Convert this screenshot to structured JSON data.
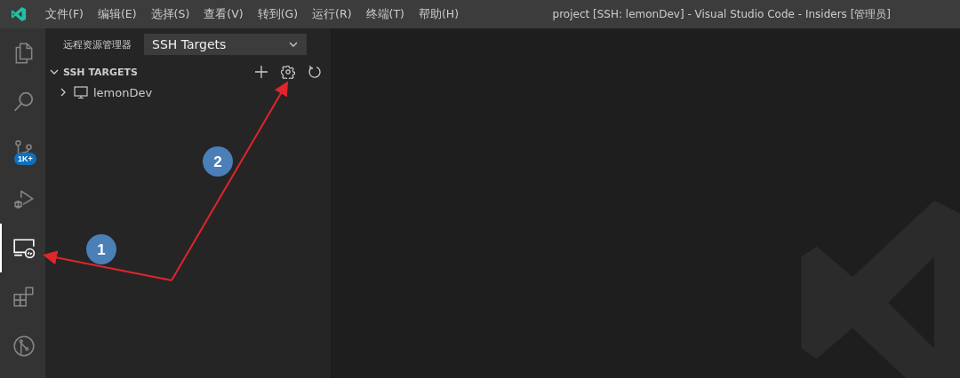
{
  "window": {
    "title": "project [SSH: lemonDev] - Visual Studio Code - Insiders [管理员]"
  },
  "menu": [
    "文件(F)",
    "编辑(E)",
    "选择(S)",
    "查看(V)",
    "转到(G)",
    "运行(R)",
    "终端(T)",
    "帮助(H)"
  ],
  "activity_bar": [
    {
      "kind": "explorer",
      "selected": false
    },
    {
      "kind": "search",
      "selected": false
    },
    {
      "kind": "source-control",
      "selected": false,
      "badge": "1K+"
    },
    {
      "kind": "run",
      "selected": false
    },
    {
      "kind": "remote",
      "selected": true
    },
    {
      "kind": "extensions",
      "selected": false
    },
    {
      "kind": "live-share",
      "selected": false
    }
  ],
  "sidebar": {
    "title": "远程资源管理器",
    "dropdown": "SSH Targets",
    "section": {
      "title": "SSH TARGETS",
      "expanded": true,
      "items": [
        {
          "label": "lemonDev",
          "expanded": false
        }
      ]
    }
  },
  "annotations": [
    "1",
    "2"
  ]
}
